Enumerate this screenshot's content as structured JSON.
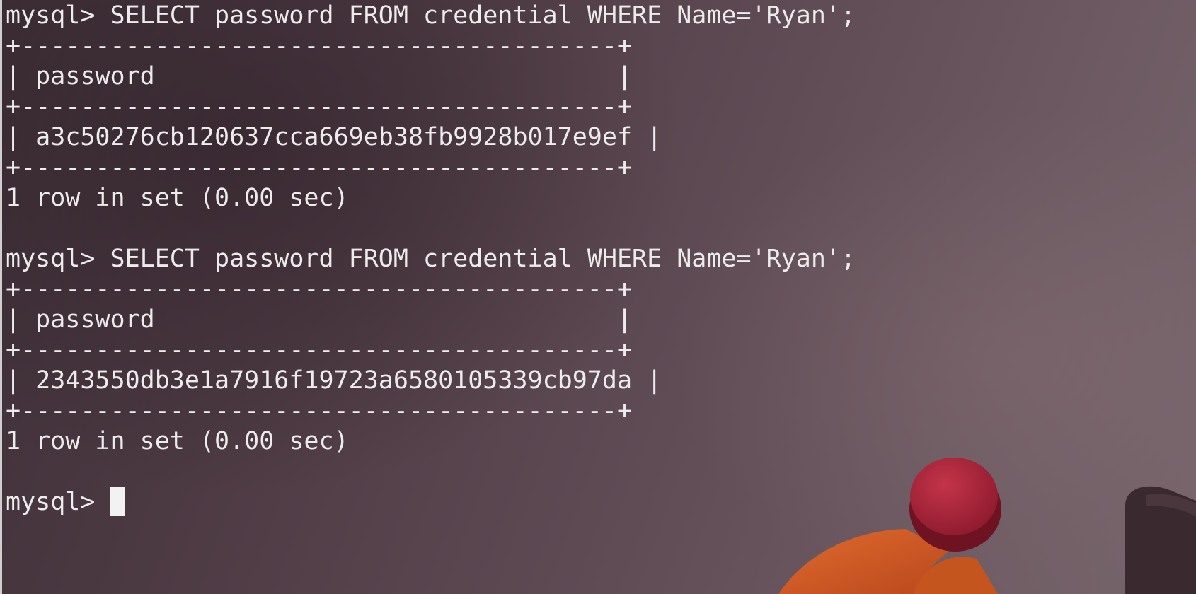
{
  "terminal": {
    "lines": [
      "mysql> SELECT password FROM credential WHERE Name='Ryan';",
      "+----------------------------------------+",
      "| password                               |",
      "+----------------------------------------+",
      "| a3c50276cb120637cca669eb38fb9928b017e9ef |",
      "+----------------------------------------+",
      "1 row in set (0.00 sec)",
      "",
      "mysql> SELECT password FROM credential WHERE Name='Ryan';",
      "+----------------------------------------+",
      "| password                               |",
      "+----------------------------------------+",
      "| 2343550db3e1a7916f19723a6580105339cb97da |",
      "+----------------------------------------+",
      "1 row in set (0.00 sec)",
      "",
      "mysql> "
    ]
  },
  "colors": {
    "text": "#ececec",
    "cursor": "#f2f2f2",
    "background": "#5e4a53"
  }
}
